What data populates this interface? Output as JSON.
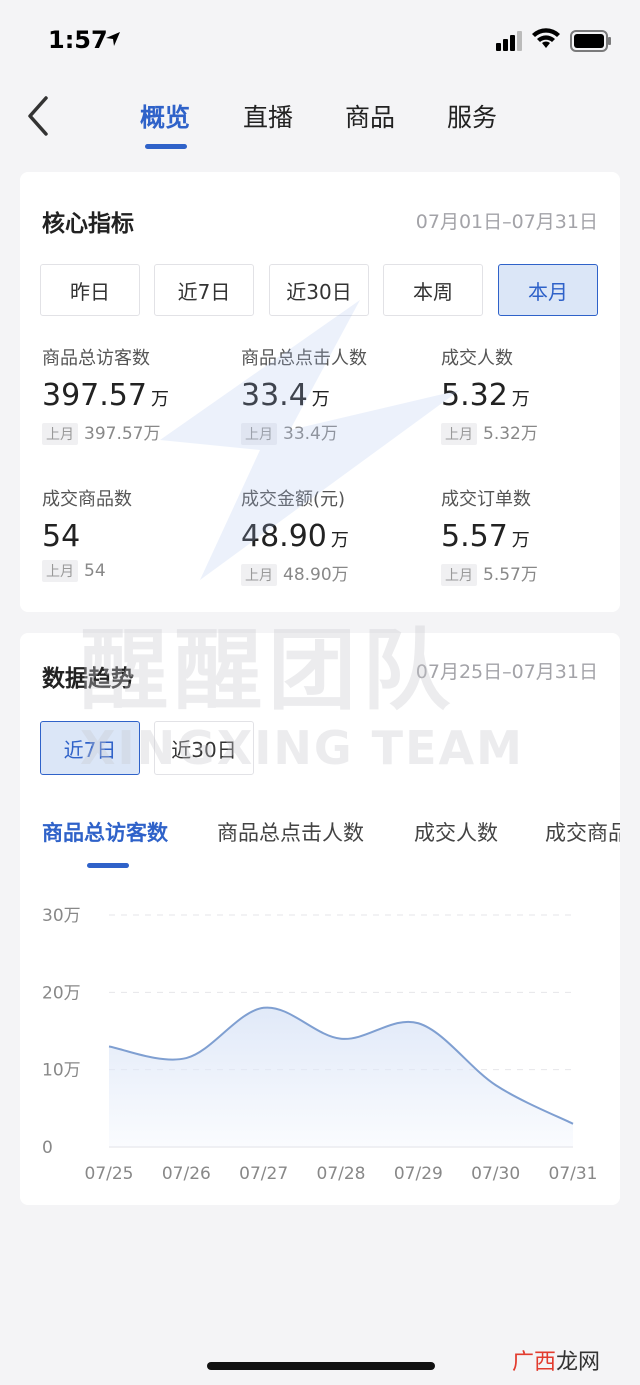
{
  "status_bar": {
    "time": "1:57"
  },
  "nav": {
    "tabs": [
      {
        "label": "概览",
        "active": true
      },
      {
        "label": "直播",
        "active": false
      },
      {
        "label": "商品",
        "active": false
      },
      {
        "label": "服务",
        "active": false
      }
    ]
  },
  "core": {
    "title": "核心指标",
    "date_range": "07月01日–07月31日",
    "periods": [
      "昨日",
      "近7日",
      "近30日",
      "本周",
      "本月"
    ],
    "selected_period": "本月",
    "prev_tag": "上月",
    "metrics": [
      {
        "label": "商品总访客数",
        "value": "397.57",
        "unit": "万",
        "prev": "397.57万"
      },
      {
        "label": "商品总点击人数",
        "value": "33.4",
        "unit": "万",
        "prev": "33.4万"
      },
      {
        "label": "成交人数",
        "value": "5.32",
        "unit": "万",
        "prev": "5.32万"
      },
      {
        "label": "成交商品数",
        "value": "54",
        "unit": "",
        "prev": "54"
      },
      {
        "label": "成交金额(元)",
        "value": "48.90",
        "unit": "万",
        "prev": "48.90万"
      },
      {
        "label": "成交订单数",
        "value": "5.57",
        "unit": "万",
        "prev": "5.57万"
      }
    ]
  },
  "trend": {
    "title": "数据趋势",
    "date_range": "07月25日–07月31日",
    "ranges": [
      "近7日",
      "近30日"
    ],
    "selected_range": "近7日",
    "metric_tabs": [
      "商品总访客数",
      "商品总点击人数",
      "成交人数",
      "成交商品数"
    ],
    "selected_metric": "商品总访客数"
  },
  "chart_data": {
    "type": "area",
    "categories": [
      "07/25",
      "07/26",
      "07/27",
      "07/28",
      "07/29",
      "07/30",
      "07/31"
    ],
    "values": [
      13,
      11.5,
      18,
      14,
      16,
      8,
      3
    ],
    "y_ticks": [
      "0",
      "10万",
      "20万",
      "30万"
    ],
    "ylim": [
      0,
      30
    ],
    "grid": true,
    "line_color": "#7f9fd1",
    "fill_color": "#dfe8f8"
  },
  "watermark": {
    "cn": "醒醒团队",
    "en": "XINGXING TEAM"
  },
  "corner_logo": {
    "red": "广西",
    "rest": "龙网"
  },
  "colors": {
    "accent": "#2f62c9",
    "active_bg": "#dbe6f7"
  }
}
